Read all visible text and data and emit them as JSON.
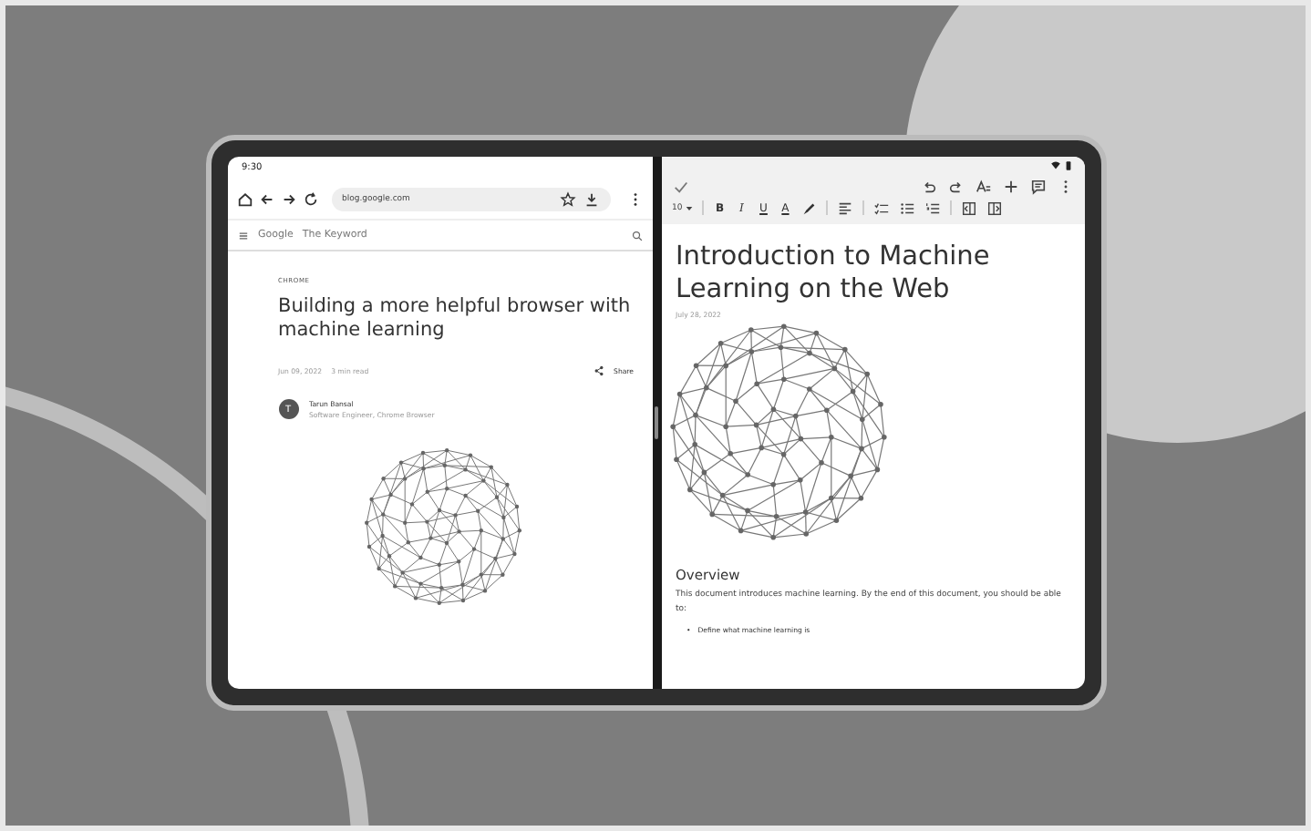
{
  "status_bar": {
    "time": "9:30"
  },
  "browser": {
    "url": "blog.google.com",
    "site_logo": "Google",
    "site_name": "The Keyword",
    "category": "CHROME",
    "headline": "Building a more helpful browser with machine learning",
    "date": "Jun 09, 2022",
    "read_time": "3 min read",
    "share": "Share",
    "author": {
      "initial": "T",
      "name": "Tarun Bansal",
      "role": "Software Engineer, Chrome Browser"
    }
  },
  "editor": {
    "font_size": "10",
    "format_buttons": [
      "B",
      "I",
      "U",
      "A"
    ],
    "title": "Introduction to Machine Learning on the Web",
    "date": "July 28, 2022",
    "section_heading": "Overview",
    "paragraph": "This document introduces machine learning. By the end of this document, you should be able to:",
    "list_items": [
      {
        "marker": "•",
        "text": "Define what machine learning is"
      }
    ]
  }
}
